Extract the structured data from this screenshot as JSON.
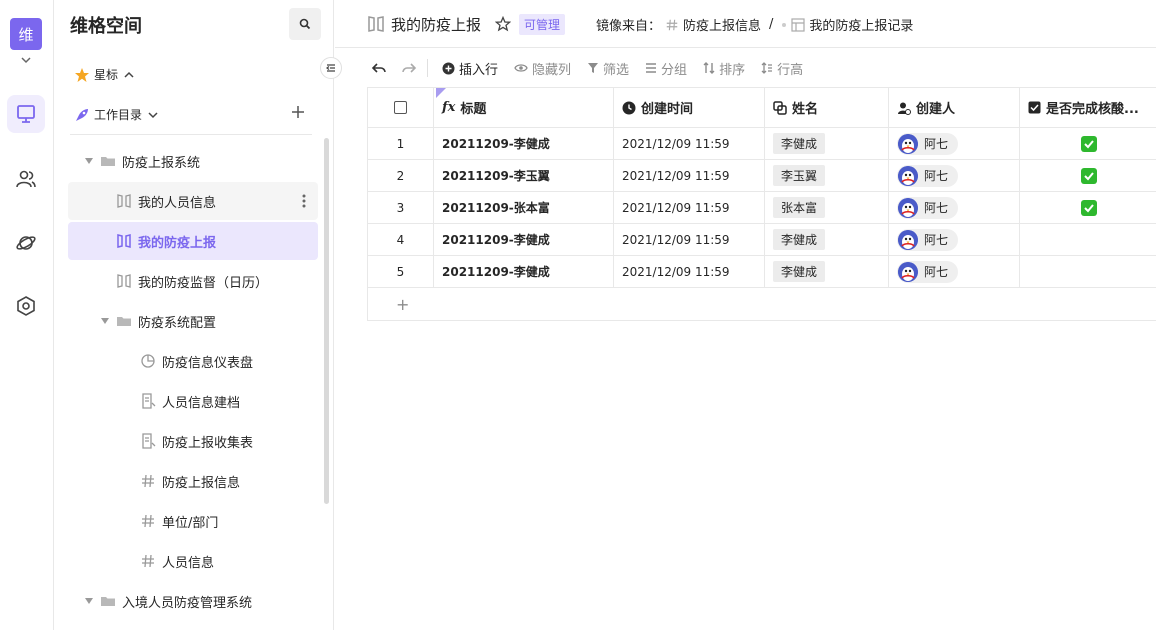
{
  "colors": {
    "accent": "#7b67ee",
    "accent_bg": "#ebe7fd",
    "check_green": "#2eb82e"
  },
  "rail": {
    "space_initial": "维",
    "items": [
      {
        "icon": "monitor-icon",
        "active": true
      },
      {
        "icon": "users-icon",
        "active": false
      },
      {
        "icon": "planet-icon",
        "active": false
      },
      {
        "icon": "settings-hexagon-icon",
        "active": false
      }
    ]
  },
  "sidebar": {
    "title": "维格空间",
    "star_label": "星标",
    "workdir_label": "工作目录",
    "tree": [
      {
        "label": "防疫上报系统",
        "type": "folder",
        "level": 0
      },
      {
        "label": "我的人员信息",
        "type": "mirror",
        "level": 1,
        "state": "hover"
      },
      {
        "label": "我的防疫上报",
        "type": "mirror",
        "level": 1,
        "state": "selected"
      },
      {
        "label": "我的防疫监督（日历）",
        "type": "mirror",
        "level": 1
      },
      {
        "label": "防疫系统配置",
        "type": "folder",
        "level": 1
      },
      {
        "label": "防疫信息仪表盘",
        "type": "dashboard",
        "level": 2
      },
      {
        "label": "人员信息建档",
        "type": "form",
        "level": 2
      },
      {
        "label": "防疫上报收集表",
        "type": "form",
        "level": 2
      },
      {
        "label": "防疫上报信息",
        "type": "datasheet",
        "level": 2
      },
      {
        "label": "单位/部门",
        "type": "datasheet",
        "level": 2
      },
      {
        "label": "人员信息",
        "type": "datasheet",
        "level": 2
      },
      {
        "label": "入境人员防疫管理系统",
        "type": "folder",
        "level": 0
      }
    ]
  },
  "header": {
    "title": "我的防疫上报",
    "badge": "可管理",
    "mirror_prefix": "镜像来自：",
    "mirror_source": "防疫上报信息",
    "separator": "/",
    "mirror_view": "我的防疫上报记录"
  },
  "toolbar": {
    "insert_row": "插入行",
    "hide_cols": "隐藏列",
    "filter": "筛选",
    "group": "分组",
    "sort": "排序",
    "row_height": "行高"
  },
  "table": {
    "columns": [
      "标题",
      "创建时间",
      "姓名",
      "创建人",
      "是否完成核酸..."
    ],
    "rows": [
      {
        "num": "1",
        "title": "20211209-李健成",
        "time": "2021/12/09 11:59",
        "name": "李健成",
        "creator": "阿七",
        "done": true
      },
      {
        "num": "2",
        "title": "20211209-李玉翼",
        "time": "2021/12/09 11:59",
        "name": "李玉翼",
        "creator": "阿七",
        "done": true
      },
      {
        "num": "3",
        "title": "20211209-张本富",
        "time": "2021/12/09 11:59",
        "name": "张本富",
        "creator": "阿七",
        "done": true
      },
      {
        "num": "4",
        "title": "20211209-李健成",
        "time": "2021/12/09 11:59",
        "name": "李健成",
        "creator": "阿七",
        "done": false
      },
      {
        "num": "5",
        "title": "20211209-李健成",
        "time": "2021/12/09 11:59",
        "name": "李健成",
        "creator": "阿七",
        "done": false
      }
    ],
    "add_row_symbol": "+"
  }
}
